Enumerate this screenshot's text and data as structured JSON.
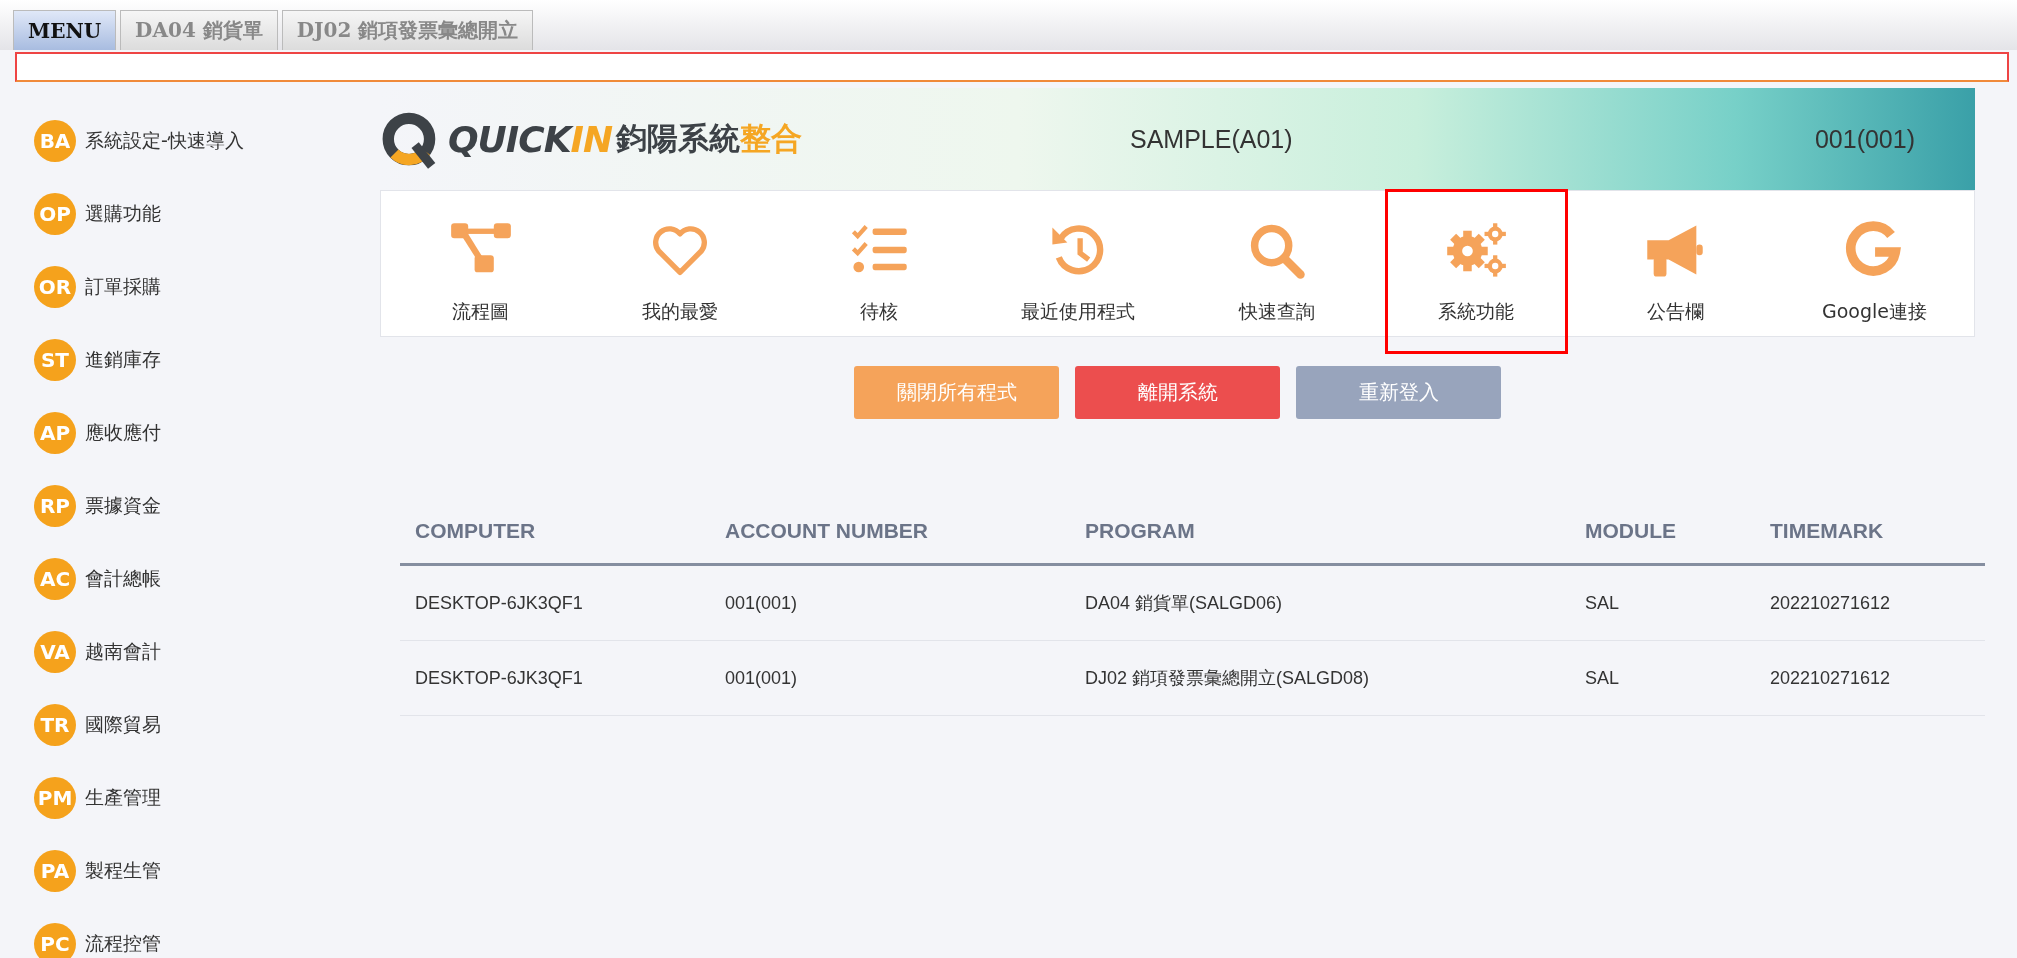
{
  "tabs": [
    {
      "label": "MENU",
      "selected": true
    },
    {
      "label": "DA04 銷貨單",
      "selected": false
    },
    {
      "label": "DJ02 銷項發票彙總開立",
      "selected": false
    }
  ],
  "sidebar": {
    "items": [
      {
        "code": "BA",
        "label": "系統設定-快速導入"
      },
      {
        "code": "OP",
        "label": "選購功能"
      },
      {
        "code": "OR",
        "label": "訂單採購"
      },
      {
        "code": "ST",
        "label": "進銷庫存"
      },
      {
        "code": "AP",
        "label": "應收應付"
      },
      {
        "code": "RP",
        "label": "票據資金"
      },
      {
        "code": "AC",
        "label": "會計總帳"
      },
      {
        "code": "VA",
        "label": "越南會計"
      },
      {
        "code": "TR",
        "label": "國際貿易"
      },
      {
        "code": "PM",
        "label": "生產管理"
      },
      {
        "code": "PA",
        "label": "製程生管"
      },
      {
        "code": "PC",
        "label": "流程控管"
      }
    ]
  },
  "header": {
    "logo_text": "QUICK",
    "logo_accent": "IN",
    "brand": "鈞陽系統",
    "brand_accent": "整合",
    "company": "SAMPLE(A01)",
    "user": "001(001)"
  },
  "shortcuts": [
    {
      "kind": "flowchart",
      "label": "流程圖",
      "highlighted": false
    },
    {
      "kind": "heart",
      "label": "我的最愛",
      "highlighted": false
    },
    {
      "kind": "checklist",
      "label": "待核",
      "highlighted": false
    },
    {
      "kind": "history",
      "label": "最近使用程式",
      "highlighted": false
    },
    {
      "kind": "search",
      "label": "快速查詢",
      "highlighted": false
    },
    {
      "kind": "gears",
      "label": "系統功能",
      "highlighted": true
    },
    {
      "kind": "megaphone",
      "label": "公告欄",
      "highlighted": false
    },
    {
      "kind": "google",
      "label": "Google連接",
      "highlighted": false
    }
  ],
  "buttons": [
    {
      "kind": "close-all",
      "label": "關閉所有程式"
    },
    {
      "kind": "exit",
      "label": "離開系統"
    },
    {
      "kind": "relogin",
      "label": "重新登入"
    }
  ],
  "table": {
    "columns": [
      "COMPUTER",
      "ACCOUNT NUMBER",
      "PROGRAM",
      "MODULE",
      "TIMEMARK"
    ],
    "rows": [
      [
        "DESKTOP-6JK3QF1",
        "001(001)",
        "DA04 銷貨單(SALGD06)",
        "SAL",
        "202210271612"
      ],
      [
        "DESKTOP-6JK3QF1",
        "001(001)",
        "DJ02 銷項發票彙總開立(SALGD08)",
        "SAL",
        "202210271612"
      ]
    ]
  }
}
